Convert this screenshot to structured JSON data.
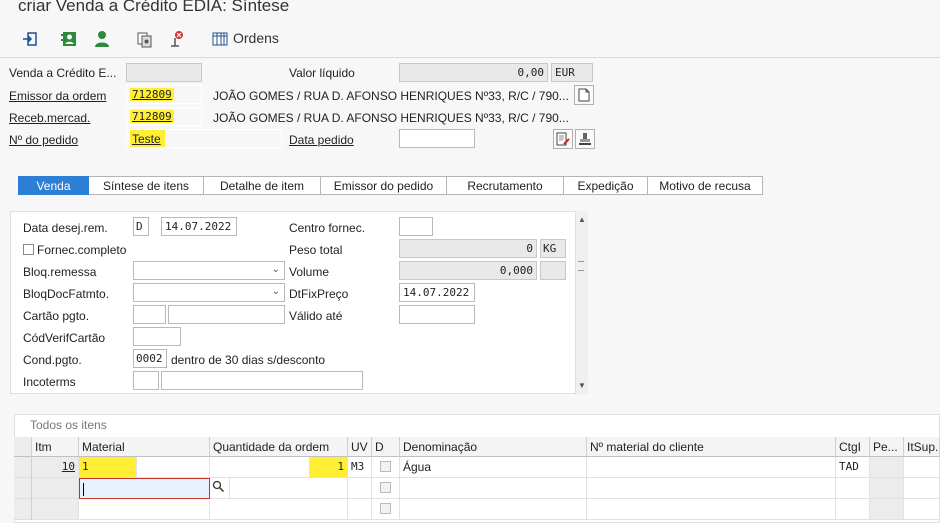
{
  "window": {
    "title": "criar Venda a Crédito EDIA: Síntese"
  },
  "toolbar": {
    "icons": [
      "enter-icon",
      "address-book-icon",
      "person-icon",
      "copy-icon",
      "delete-icon",
      "table-icon"
    ],
    "ordens_label": "Ordens"
  },
  "header": {
    "venda_credito_label": "Venda a Crédito E...",
    "venda_credito_value": "",
    "valor_liquido_label": "Valor líquido",
    "valor_liquido_value": "0,00",
    "currency": "EUR",
    "emissor_label": "Emissor da ordem",
    "emissor_value": "712809",
    "emissor_desc": "JOÃO GOMES / RUA D. AFONSO HENRIQUES Nº33, R/C / 790...",
    "receb_label": "Receb.mercad.",
    "receb_value": "712809",
    "receb_desc": "JOÃO GOMES / RUA D. AFONSO HENRIQUES Nº33, R/C / 790...",
    "pedido_label": "Nº do pedido",
    "pedido_value": "Teste",
    "data_pedido_label": "Data pedido",
    "data_pedido_value": ""
  },
  "tabs": [
    {
      "label": "Venda",
      "active": true
    },
    {
      "label": "Síntese de itens"
    },
    {
      "label": "Detalhe de item"
    },
    {
      "label": "Emissor do pedido"
    },
    {
      "label": "Recrutamento"
    },
    {
      "label": "Expedição"
    },
    {
      "label": "Motivo de recusa"
    }
  ],
  "venda": {
    "data_desej_label": "Data desej.rem.",
    "data_desej_type": "D",
    "data_desej_value": "14.07.2022",
    "centro_label": "Centro fornec.",
    "centro_value": "",
    "fornec_completo_label": "Fornec.completo",
    "peso_label": "Peso total",
    "peso_value": "0",
    "peso_unit": "KG",
    "bloq_remessa_label": "Bloq.remessa",
    "volume_label": "Volume",
    "volume_value": "0,000",
    "bloq_doc_label": "BloqDocFatmto.",
    "dtfix_label": "DtFixPreço",
    "dtfix_value": "14.07.2022",
    "cartao_label": "Cartão pgto.",
    "valido_label": "Válido até",
    "codverif_label": "CódVerifCartão",
    "cond_label": "Cond.pgto.",
    "cond_value": "0002",
    "cond_desc": "dentro de 30 dias s/desconto",
    "incoterms_label": "Incoterms"
  },
  "items": {
    "section_title": "Todos os itens",
    "columns": [
      "Itm",
      "Material",
      "Quantidade da ordem",
      "UV",
      "D",
      "Denominação",
      "Nº material do cliente",
      "CtgI",
      "Pe...",
      "ItSup."
    ],
    "rows": [
      {
        "itm": "10",
        "material": "1",
        "quantidade": "1",
        "uv": "M3",
        "denominacao": "Água",
        "ctgi": "TAD"
      }
    ]
  }
}
